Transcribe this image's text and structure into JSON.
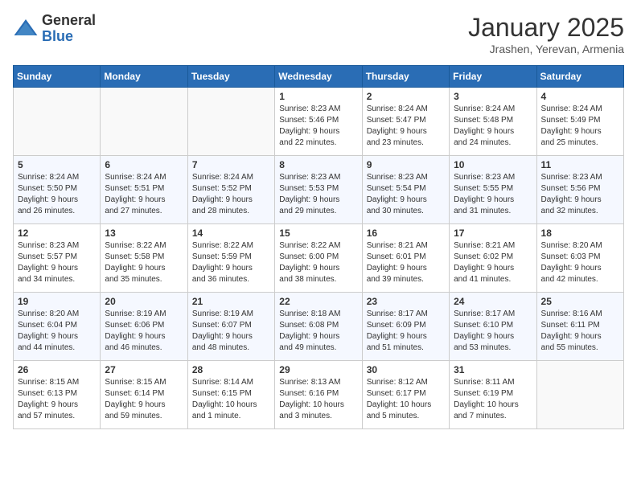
{
  "header": {
    "logo_general": "General",
    "logo_blue": "Blue",
    "month_title": "January 2025",
    "subtitle": "Jrashen, Yerevan, Armenia"
  },
  "weekdays": [
    "Sunday",
    "Monday",
    "Tuesday",
    "Wednesday",
    "Thursday",
    "Friday",
    "Saturday"
  ],
  "weeks": [
    [
      {
        "day": "",
        "content": ""
      },
      {
        "day": "",
        "content": ""
      },
      {
        "day": "",
        "content": ""
      },
      {
        "day": "1",
        "content": "Sunrise: 8:23 AM\nSunset: 5:46 PM\nDaylight: 9 hours\nand 22 minutes."
      },
      {
        "day": "2",
        "content": "Sunrise: 8:24 AM\nSunset: 5:47 PM\nDaylight: 9 hours\nand 23 minutes."
      },
      {
        "day": "3",
        "content": "Sunrise: 8:24 AM\nSunset: 5:48 PM\nDaylight: 9 hours\nand 24 minutes."
      },
      {
        "day": "4",
        "content": "Sunrise: 8:24 AM\nSunset: 5:49 PM\nDaylight: 9 hours\nand 25 minutes."
      }
    ],
    [
      {
        "day": "5",
        "content": "Sunrise: 8:24 AM\nSunset: 5:50 PM\nDaylight: 9 hours\nand 26 minutes."
      },
      {
        "day": "6",
        "content": "Sunrise: 8:24 AM\nSunset: 5:51 PM\nDaylight: 9 hours\nand 27 minutes."
      },
      {
        "day": "7",
        "content": "Sunrise: 8:24 AM\nSunset: 5:52 PM\nDaylight: 9 hours\nand 28 minutes."
      },
      {
        "day": "8",
        "content": "Sunrise: 8:23 AM\nSunset: 5:53 PM\nDaylight: 9 hours\nand 29 minutes."
      },
      {
        "day": "9",
        "content": "Sunrise: 8:23 AM\nSunset: 5:54 PM\nDaylight: 9 hours\nand 30 minutes."
      },
      {
        "day": "10",
        "content": "Sunrise: 8:23 AM\nSunset: 5:55 PM\nDaylight: 9 hours\nand 31 minutes."
      },
      {
        "day": "11",
        "content": "Sunrise: 8:23 AM\nSunset: 5:56 PM\nDaylight: 9 hours\nand 32 minutes."
      }
    ],
    [
      {
        "day": "12",
        "content": "Sunrise: 8:23 AM\nSunset: 5:57 PM\nDaylight: 9 hours\nand 34 minutes."
      },
      {
        "day": "13",
        "content": "Sunrise: 8:22 AM\nSunset: 5:58 PM\nDaylight: 9 hours\nand 35 minutes."
      },
      {
        "day": "14",
        "content": "Sunrise: 8:22 AM\nSunset: 5:59 PM\nDaylight: 9 hours\nand 36 minutes."
      },
      {
        "day": "15",
        "content": "Sunrise: 8:22 AM\nSunset: 6:00 PM\nDaylight: 9 hours\nand 38 minutes."
      },
      {
        "day": "16",
        "content": "Sunrise: 8:21 AM\nSunset: 6:01 PM\nDaylight: 9 hours\nand 39 minutes."
      },
      {
        "day": "17",
        "content": "Sunrise: 8:21 AM\nSunset: 6:02 PM\nDaylight: 9 hours\nand 41 minutes."
      },
      {
        "day": "18",
        "content": "Sunrise: 8:20 AM\nSunset: 6:03 PM\nDaylight: 9 hours\nand 42 minutes."
      }
    ],
    [
      {
        "day": "19",
        "content": "Sunrise: 8:20 AM\nSunset: 6:04 PM\nDaylight: 9 hours\nand 44 minutes."
      },
      {
        "day": "20",
        "content": "Sunrise: 8:19 AM\nSunset: 6:06 PM\nDaylight: 9 hours\nand 46 minutes."
      },
      {
        "day": "21",
        "content": "Sunrise: 8:19 AM\nSunset: 6:07 PM\nDaylight: 9 hours\nand 48 minutes."
      },
      {
        "day": "22",
        "content": "Sunrise: 8:18 AM\nSunset: 6:08 PM\nDaylight: 9 hours\nand 49 minutes."
      },
      {
        "day": "23",
        "content": "Sunrise: 8:17 AM\nSunset: 6:09 PM\nDaylight: 9 hours\nand 51 minutes."
      },
      {
        "day": "24",
        "content": "Sunrise: 8:17 AM\nSunset: 6:10 PM\nDaylight: 9 hours\nand 53 minutes."
      },
      {
        "day": "25",
        "content": "Sunrise: 8:16 AM\nSunset: 6:11 PM\nDaylight: 9 hours\nand 55 minutes."
      }
    ],
    [
      {
        "day": "26",
        "content": "Sunrise: 8:15 AM\nSunset: 6:13 PM\nDaylight: 9 hours\nand 57 minutes."
      },
      {
        "day": "27",
        "content": "Sunrise: 8:15 AM\nSunset: 6:14 PM\nDaylight: 9 hours\nand 59 minutes."
      },
      {
        "day": "28",
        "content": "Sunrise: 8:14 AM\nSunset: 6:15 PM\nDaylight: 10 hours\nand 1 minute."
      },
      {
        "day": "29",
        "content": "Sunrise: 8:13 AM\nSunset: 6:16 PM\nDaylight: 10 hours\nand 3 minutes."
      },
      {
        "day": "30",
        "content": "Sunrise: 8:12 AM\nSunset: 6:17 PM\nDaylight: 10 hours\nand 5 minutes."
      },
      {
        "day": "31",
        "content": "Sunrise: 8:11 AM\nSunset: 6:19 PM\nDaylight: 10 hours\nand 7 minutes."
      },
      {
        "day": "",
        "content": ""
      }
    ]
  ]
}
